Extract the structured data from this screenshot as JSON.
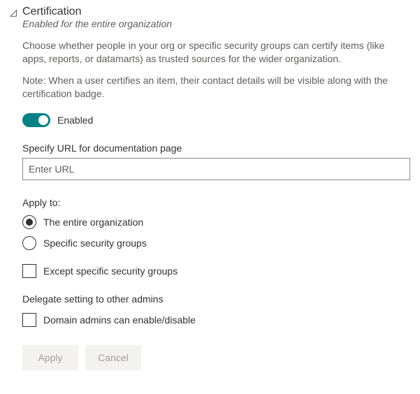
{
  "header": {
    "title": "Certification",
    "subtitle": "Enabled for the entire organization"
  },
  "description": {
    "main": "Choose whether people in your org or specific security groups can certify items (like apps, reports, or datamarts) as trusted sources for the wider organization.",
    "note": "Note: When a user certifies an item, their contact details will be visible along with the certification badge."
  },
  "toggle": {
    "label": "Enabled"
  },
  "url_field": {
    "label": "Specify URL for documentation page",
    "placeholder": "Enter URL"
  },
  "apply_to": {
    "label": "Apply to:",
    "options": {
      "entire_org": "The entire organization",
      "specific_groups": "Specific security groups"
    },
    "except_label": "Except specific security groups"
  },
  "delegate": {
    "label": "Delegate setting to other admins",
    "checkbox_label": "Domain admins can enable/disable"
  },
  "buttons": {
    "apply": "Apply",
    "cancel": "Cancel"
  }
}
